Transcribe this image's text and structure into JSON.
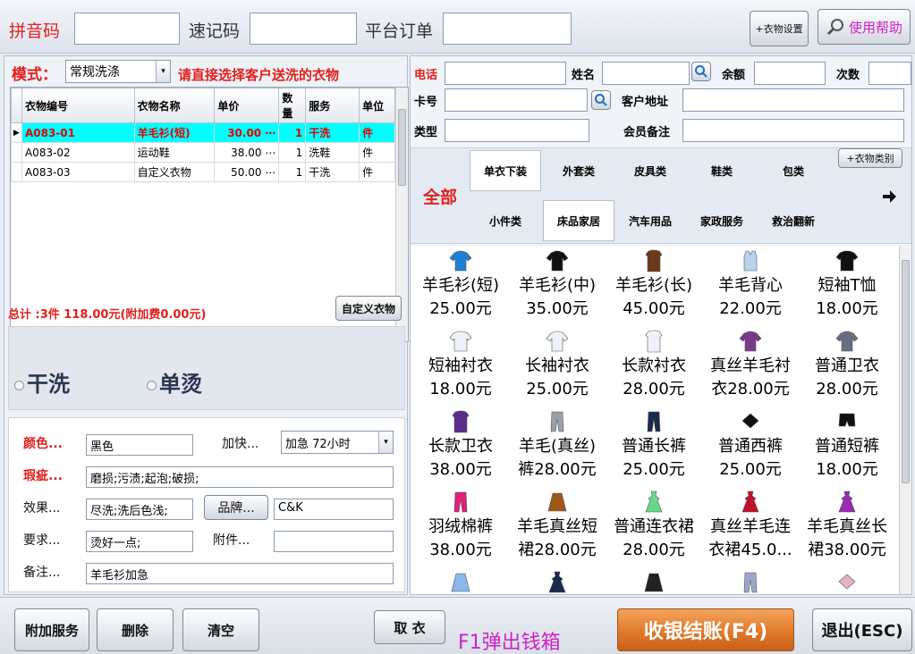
{
  "top": {
    "pinyin_label": "拼音码",
    "suji_label": "速记码",
    "platform_label": "平台订单",
    "clothing_setting": "+衣物设置",
    "help": "使用帮助"
  },
  "mode": {
    "label": "模式：",
    "value": "常规洗涤",
    "hint": "请直接选择客户送洗的衣物"
  },
  "grid": {
    "headers": [
      "衣物编号",
      "衣物名称",
      "单价",
      "数量",
      "服务",
      "单位"
    ],
    "rows": [
      {
        "code": "A083-01",
        "name": "羊毛衫(短)",
        "price": "30.00",
        "qty": "1",
        "service": "干洗",
        "unit": "件"
      },
      {
        "code": "A083-02",
        "name": "运动鞋",
        "price": "38.00",
        "qty": "1",
        "service": "洗鞋",
        "unit": "件"
      },
      {
        "code": "A083-03",
        "name": "自定义衣物",
        "price": "50.00",
        "qty": "1",
        "service": "干洗",
        "unit": "件"
      }
    ]
  },
  "summary": {
    "total": "总计 :3件 118.00元(附加费0.00元)",
    "custom_button": "自定义衣物"
  },
  "services": {
    "dry": "干洗",
    "iron": "单烫"
  },
  "form": {
    "color_label": "颜色...",
    "color_value": "黑色",
    "urgent_label": "加快...",
    "urgent_value": "加急 72小时",
    "defect_label": "瑕疵...",
    "defect_value": "磨损;污渍;起泡;破损;",
    "effect_label": "效果...",
    "effect_value": "尽洗;洗后色浅;",
    "brand_label": "品牌...",
    "brand_value": "C&K",
    "require_label": "要求...",
    "require_value": "烫好一点;",
    "attach_label": "附件...",
    "attach_value": "",
    "remark_label": "备注...",
    "remark_value": "羊毛衫加急"
  },
  "customer": {
    "phone": "电话",
    "name": "姓名",
    "balance": "余额",
    "count": "次数",
    "card": "卡号",
    "address": "客户地址",
    "type": "类型",
    "member_note": "会员备注"
  },
  "categories": {
    "all": "全部",
    "add": "+衣物类别",
    "row1": [
      "单衣下装",
      "外套类",
      "皮具类",
      "鞋类",
      "包类"
    ],
    "row2": [
      "小件类",
      "床品家居",
      "汽车用品",
      "家政服务",
      "救治翻新"
    ]
  },
  "products": [
    {
      "name": "羊毛衫(短)",
      "price": "25.00元",
      "color": "#1e7fd6",
      "shape": "sweater"
    },
    {
      "name": "羊毛衫(中)",
      "price": "35.00元",
      "color": "#111111",
      "shape": "sweater"
    },
    {
      "name": "羊毛衫(长)",
      "price": "45.00元",
      "color": "#6b3a1e",
      "shape": "coat"
    },
    {
      "name": "羊毛背心",
      "price": "22.00元",
      "color": "#b9d3ee",
      "shape": "vest"
    },
    {
      "name": "短袖T恤",
      "price": "18.00元",
      "color": "#111111",
      "shape": "tshirt"
    },
    {
      "name": "短袖衬衣",
      "price": "18.00元",
      "color": "#eef2f8",
      "shape": "tshirt"
    },
    {
      "name": "长袖衬衣",
      "price": "25.00元",
      "color": "#eef2f8",
      "shape": "sweater"
    },
    {
      "name": "长款衬衣",
      "price": "28.00元",
      "color": "#eef2f8",
      "shape": "coat"
    },
    {
      "name": "真丝羊毛衬",
      "price": "衣28.00元",
      "color": "#7a3a8a",
      "shape": "sweater"
    },
    {
      "name": "普通卫衣",
      "price": "28.00元",
      "color": "#666f80",
      "shape": "sweater"
    },
    {
      "name": "长款卫衣",
      "price": "38.00元",
      "color": "#5a2d8a",
      "shape": "coat"
    },
    {
      "name": "羊毛(真丝)",
      "price": "裤28.00元",
      "color": "#9aa0aa",
      "shape": "pants"
    },
    {
      "name": "普通长裤",
      "price": "25.00元",
      "color": "#1a2a4a",
      "shape": "pants"
    },
    {
      "name": "普通西裤",
      "price": "25.00元",
      "color": "#111111",
      "shape": "folded"
    },
    {
      "name": "普通短裤",
      "price": "18.00元",
      "color": "#111111",
      "shape": "shorts"
    },
    {
      "name": "羽绒棉裤",
      "price": "38.00元",
      "color": "#e0207a",
      "shape": "pants"
    },
    {
      "name": "羊毛真丝短",
      "price": "裙28.00元",
      "color": "#a0581a",
      "shape": "skirt"
    },
    {
      "name": "普通连衣裙",
      "price": "28.00元",
      "color": "#6ad68a",
      "shape": "dress"
    },
    {
      "name": "真丝羊毛连",
      "price": "衣裙45.0...",
      "color": "#c0102a",
      "shape": "dress"
    },
    {
      "name": "羊毛真丝长",
      "price": "裙38.00元",
      "color": "#9a2ab0",
      "shape": "dress"
    },
    {
      "name": "",
      "price": "",
      "color": "#8ab8e8",
      "shape": "skirt"
    },
    {
      "name": "",
      "price": "",
      "color": "#1a2a4a",
      "shape": "dress"
    },
    {
      "name": "",
      "price": "",
      "color": "#222222",
      "shape": "skirt"
    },
    {
      "name": "",
      "price": "",
      "color": "#9aa8c8",
      "shape": "pants"
    },
    {
      "name": "",
      "price": "",
      "color": "#e8b0c8",
      "shape": "folded"
    }
  ],
  "bottom": {
    "extra": "附加服务",
    "delete": "删除",
    "clear": "清空",
    "pickup": "取 衣",
    "cashbox": "F1弹出钱箱",
    "checkout": "收银结账(F4)",
    "exit": "退出(ESC)"
  }
}
